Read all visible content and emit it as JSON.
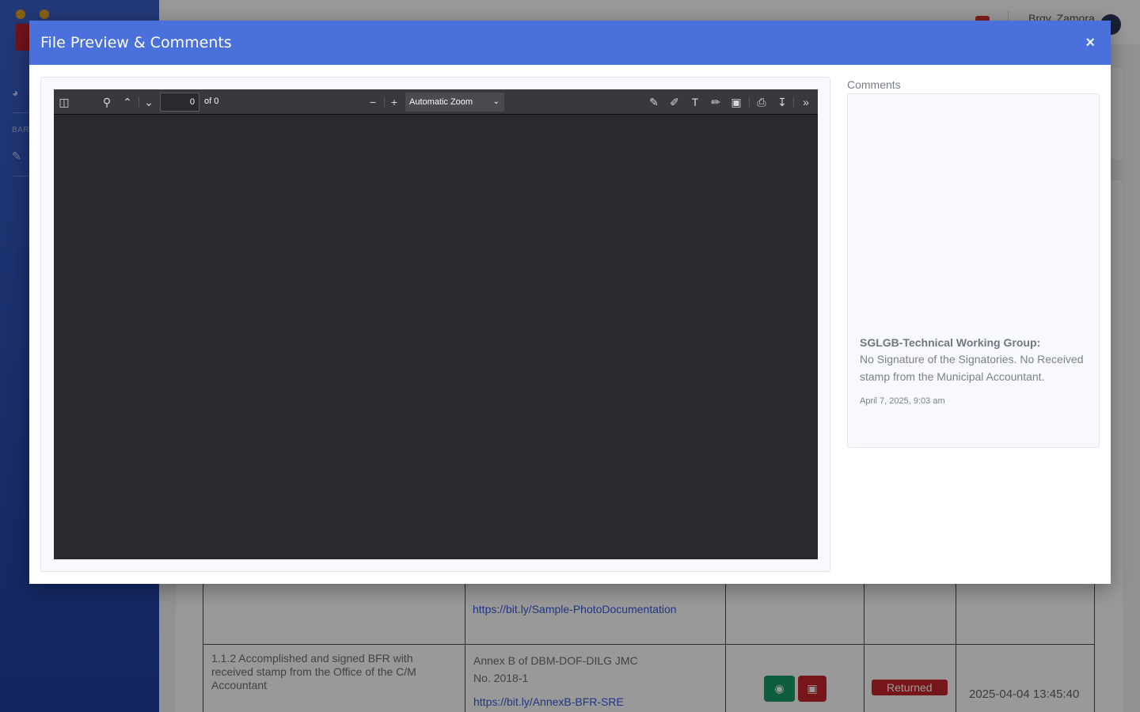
{
  "background": {
    "user_name": "Brgy. Zamora",
    "sidebar_heading": "BAR",
    "table": {
      "row1": {
        "link": "https://bit.ly/Sample-PhotoDocumentation"
      },
      "row2": {
        "indicator": "1.1.2 Accomplished and signed BFR with received stamp from the Office of the C/M Accountant",
        "reference_line1": "Annex B of DBM-DOF-DILG JMC",
        "reference_line2": "No. 2018-1",
        "reference_link": "https://bit.ly/AnnexB-BFR-SRE",
        "status": "Returned",
        "date": "2025-04-04 13:45:40"
      }
    }
  },
  "modal": {
    "title": "File Preview & Comments",
    "close_label": "×"
  },
  "viewer": {
    "page_value": "0",
    "page_of": "of 0",
    "zoom": "Automatic Zoom"
  },
  "comments": {
    "label": "Comments",
    "items": [
      {
        "author": "SGLGB-Technical Working Group:",
        "text": "No Signature of the Signatories. No Received stamp from the Municipal Accountant.",
        "date": "April 7, 2025, 9:03 am"
      }
    ]
  },
  "colors": {
    "modal_header": "#4a70dc",
    "viewer_bg": "#2a2a2e",
    "viewer_toolbar": "#38383d",
    "status_returned": "#c7262c",
    "view_button": "#1a9b6a"
  }
}
